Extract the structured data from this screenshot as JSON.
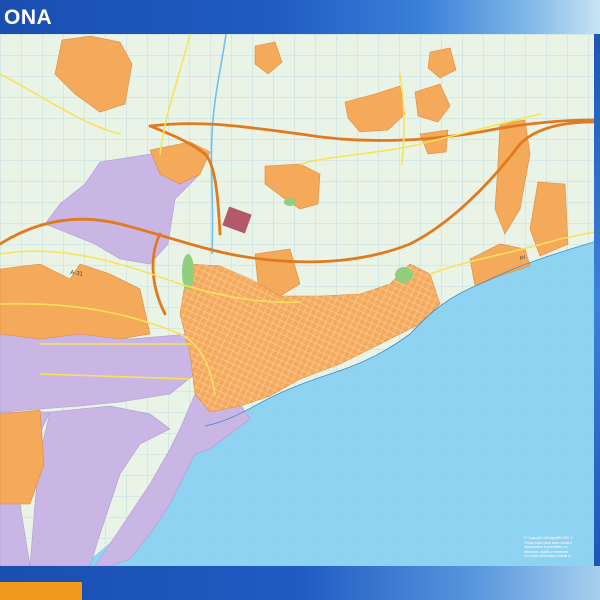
{
  "map": {
    "title": "ONA",
    "copyright_lines": [
      "© Copyright Ultimapsis® 1997-2",
      "These maps have been created",
      "reproduction is prohibited, ex",
      "electronic, digital or mechanic",
      "For more information consult w"
    ],
    "colors": {
      "sea": "#8fd3f2",
      "land": "#e9f4e6",
      "residential": "#f4a95b",
      "industrial": "#c9b6e4",
      "highway": "#e07a1f",
      "road": "#f7e35a",
      "frame": "#0d3c8c",
      "accent_tab": "#f39a1e"
    }
  }
}
